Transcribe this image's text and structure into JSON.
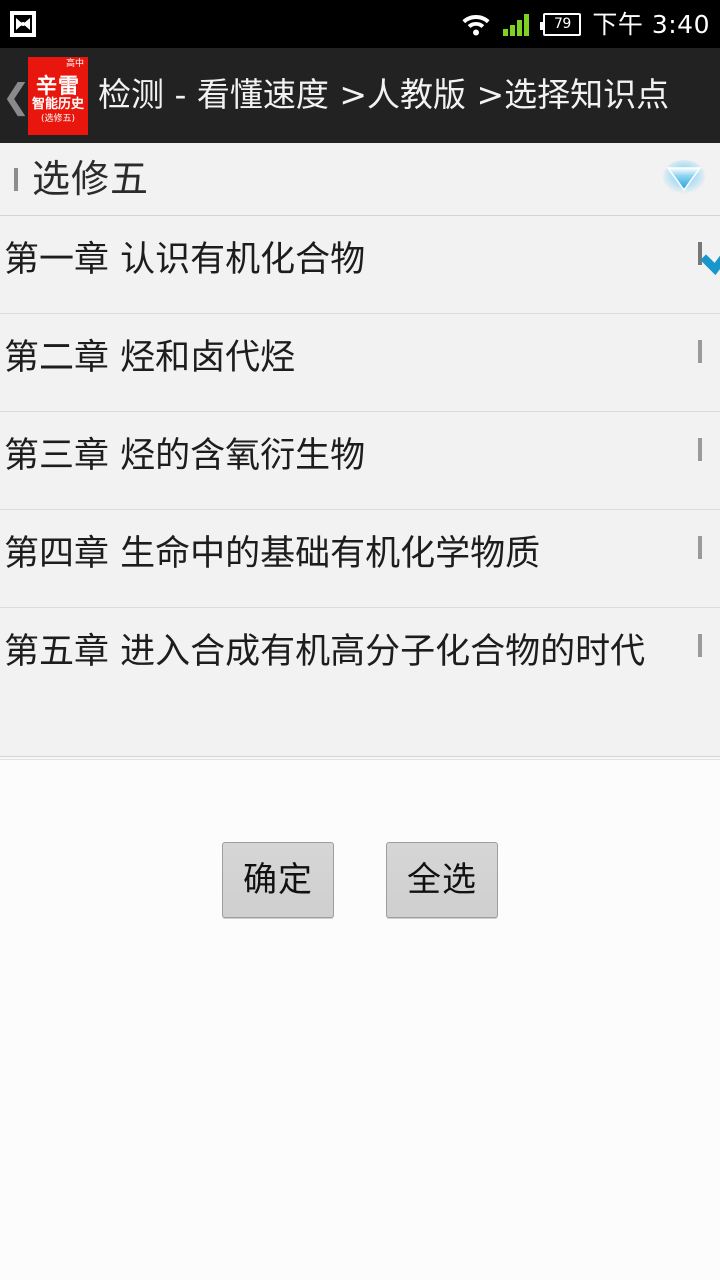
{
  "statusbar": {
    "notification_icon": "butterfly-app-icon",
    "wifi_icon": "wifi-icon",
    "signal_icon": "cell-signal-icon",
    "battery_icon": "battery-icon",
    "battery_level": "79",
    "clock": "下午 3:40"
  },
  "titlebar": {
    "back_icon": "❮",
    "logo": {
      "grade": "高中",
      "brand": "辛雷",
      "sub": "智能历史",
      "edition": "(选修五)",
      "color": "#e8160c"
    },
    "title": "检测 - 看懂速度 >人教版 >选择知识点"
  },
  "group_header": {
    "checkbox_checked": false,
    "label": "选修五",
    "expander_icon": "triangle-down-icon",
    "expander_color": "#29a8e0"
  },
  "list": {
    "rows": [
      {
        "label": "第一章 认识有机化合物",
        "checked": true
      },
      {
        "label": "第二章 烃和卤代烃",
        "checked": false
      },
      {
        "label": "第三章 烃的含氧衍生物",
        "checked": false
      },
      {
        "label": "第四章 生命中的基础有机化学物质",
        "checked": false
      },
      {
        "label": "第五章 进入合成有机高分子化合物的时代",
        "checked": false
      }
    ]
  },
  "buttons": {
    "confirm_label": "确定",
    "select_all_label": "全选"
  },
  "colors": {
    "accent": "#29a8e0",
    "brand_red": "#e8160c",
    "titlebar_bg": "#222222",
    "list_bg": "#f2f2f2",
    "page_bg": "#fcfcfc"
  }
}
